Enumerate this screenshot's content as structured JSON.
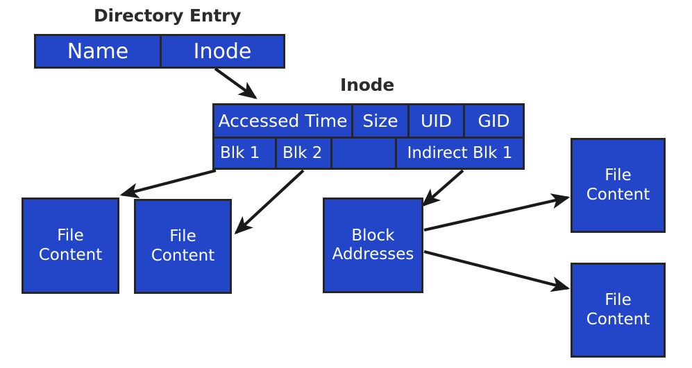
{
  "diagram": {
    "title_directory_entry": "Directory Entry",
    "title_inode": "Inode",
    "colors": {
      "box_fill": "#2346c8",
      "box_border": "#262626",
      "box_text": "#ffffff",
      "caption_text": "#2b2b2b",
      "arrow": "#1a1a1a",
      "background": "#ffffff"
    },
    "directory_entry": {
      "cells": [
        {
          "label": "Name"
        },
        {
          "label": "Inode"
        }
      ]
    },
    "inode": {
      "row1": [
        {
          "label": "Accessed Time"
        },
        {
          "label": "Size"
        },
        {
          "label": "UID"
        },
        {
          "label": "GID"
        }
      ],
      "row2": [
        {
          "label": "Blk 1"
        },
        {
          "label": "Blk 2"
        },
        {
          "label": ""
        },
        {
          "label": "Indirect Blk 1"
        }
      ]
    },
    "blocks": {
      "file_content_1_line1": "File",
      "file_content_1_line2": "Content",
      "file_content_2_line1": "File",
      "file_content_2_line2": "Content",
      "block_addresses_line1": "Block",
      "block_addresses_line2": "Addresses",
      "file_content_3_line1": "File",
      "file_content_3_line2": "Content",
      "file_content_4_line1": "File",
      "file_content_4_line2": "Content"
    },
    "arrows": [
      {
        "name": "inode-cell-to-inode-table",
        "from": "Inode cell",
        "to": "Inode table"
      },
      {
        "name": "blk1-to-file-content-1",
        "from": "Blk 1",
        "to": "File Content"
      },
      {
        "name": "blk2-to-file-content-2",
        "from": "Blk 2",
        "to": "File Content"
      },
      {
        "name": "indirect-to-block-addresses",
        "from": "Indirect Blk 1",
        "to": "Block Addresses"
      },
      {
        "name": "block-addresses-to-file-content-3",
        "from": "Block Addresses",
        "to": "File Content"
      },
      {
        "name": "block-addresses-to-file-content-4",
        "from": "Block Addresses",
        "to": "File Content"
      }
    ]
  }
}
